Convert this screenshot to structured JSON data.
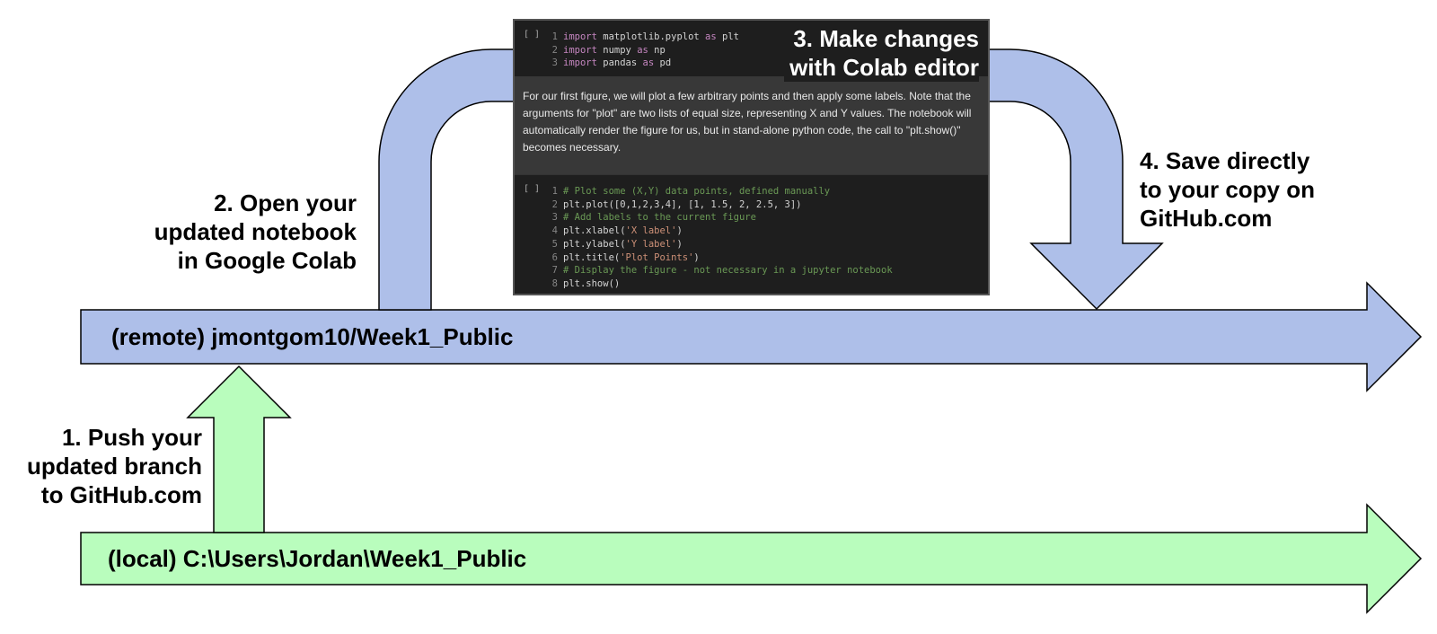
{
  "diagram": {
    "remote_branch": "(remote) jmontgom10/Week1_Public",
    "local_branch": "(local) C:\\Users\\Jordan\\Week1_Public",
    "steps": {
      "push": "1. Push your\nupdated branch\nto GitHub.com",
      "open": "2. Open your\nupdated notebook\nin Google Colab",
      "edit": "3. Make changes\nwith Colab editor",
      "save": "4. Save directly\nto your copy on\nGitHub.com"
    },
    "colors": {
      "remote_fill": "#aebfe9",
      "local_fill": "#b9fdbd",
      "stroke": "#000000"
    }
  },
  "colab": {
    "run_marker": "[ ]",
    "cell1": [
      {
        "n": "1",
        "kw": "import",
        "a": " matplotlib.pyplot ",
        "kw2": "as",
        "b": " plt"
      },
      {
        "n": "2",
        "kw": "import",
        "a": " numpy ",
        "kw2": "as",
        "b": " np"
      },
      {
        "n": "3",
        "kw": "import",
        "a": " pandas ",
        "kw2": "as",
        "b": " pd"
      }
    ],
    "text": "For our first figure, we will plot a few arbitrary points and then apply some labels. Note that the arguments for \"plot\" are two lists of equal size, representing X and Y values. The notebook will automatically render the figure for us, but in stand-alone python code, the call to \"plt.show()\" becomes necessary.",
    "cell2": [
      {
        "n": "1",
        "comment": "# Plot some (X,Y) data points, defined manually"
      },
      {
        "n": "2",
        "code": "plt.plot([0,1,2,3,4], [1, 1.5, 2, 2.5, 3])"
      },
      {
        "n": "3",
        "comment": "# Add labels to the current figure"
      },
      {
        "n": "4",
        "pre": "plt.xlabel(",
        "str": "'X label'",
        "post": ")"
      },
      {
        "n": "5",
        "pre": "plt.ylabel(",
        "str": "'Y label'",
        "post": ")"
      },
      {
        "n": "6",
        "pre": "plt.title(",
        "str": "'Plot Points'",
        "post": ")"
      },
      {
        "n": "7",
        "comment": "# Display the figure - not necessary in a jupyter notebook"
      },
      {
        "n": "8",
        "code": "plt.show()"
      }
    ]
  }
}
